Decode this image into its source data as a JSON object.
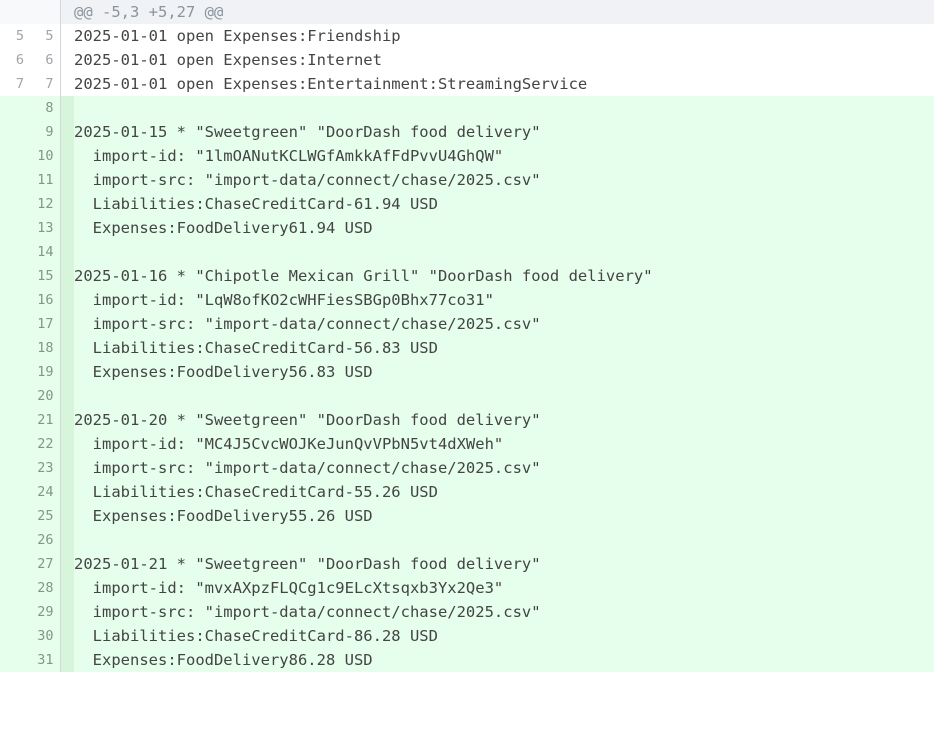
{
  "hunk_header": "@@ -5,3 +5,27 @@",
  "rows": [
    {
      "type": "hunk",
      "old": "",
      "new": "",
      "text_key": "hunk_header"
    },
    {
      "type": "context",
      "old": "5",
      "new": "5",
      "text": "2025-01-01 open Expenses:Friendship"
    },
    {
      "type": "context",
      "old": "6",
      "new": "6",
      "text": "2025-01-01 open Expenses:Internet"
    },
    {
      "type": "context",
      "old": "7",
      "new": "7",
      "text": "2025-01-01 open Expenses:Entertainment:StreamingService"
    },
    {
      "type": "added",
      "old": "",
      "new": "8",
      "text": ""
    },
    {
      "type": "added",
      "old": "",
      "new": "9",
      "text": "2025-01-15 * \"Sweetgreen\" \"DoorDash food delivery\""
    },
    {
      "type": "added",
      "old": "",
      "new": "10",
      "text": "  import-id: \"1lmOANutKCLWGfAmkkAfFdPvvU4GhQW\""
    },
    {
      "type": "added",
      "old": "",
      "new": "11",
      "text": "  import-src: \"import-data/connect/chase/2025.csv\""
    },
    {
      "type": "added",
      "old": "",
      "new": "12",
      "left": "  Liabilities:ChaseCreditCard",
      "right": "-61.94 USD"
    },
    {
      "type": "added",
      "old": "",
      "new": "13",
      "left": "  Expenses:FoodDelivery",
      "right": "61.94 USD"
    },
    {
      "type": "added",
      "old": "",
      "new": "14",
      "text": ""
    },
    {
      "type": "added",
      "old": "",
      "new": "15",
      "text": "2025-01-16 * \"Chipotle Mexican Grill\" \"DoorDash food delivery\""
    },
    {
      "type": "added",
      "old": "",
      "new": "16",
      "text": "  import-id: \"LqW8ofKO2cWHFiesSBGp0Bhx77co31\""
    },
    {
      "type": "added",
      "old": "",
      "new": "17",
      "text": "  import-src: \"import-data/connect/chase/2025.csv\""
    },
    {
      "type": "added",
      "old": "",
      "new": "18",
      "left": "  Liabilities:ChaseCreditCard",
      "right": "-56.83 USD"
    },
    {
      "type": "added",
      "old": "",
      "new": "19",
      "left": "  Expenses:FoodDelivery",
      "right": "56.83 USD"
    },
    {
      "type": "added",
      "old": "",
      "new": "20",
      "text": ""
    },
    {
      "type": "added",
      "old": "",
      "new": "21",
      "text": "2025-01-20 * \"Sweetgreen\" \"DoorDash food delivery\""
    },
    {
      "type": "added",
      "old": "",
      "new": "22",
      "text": "  import-id: \"MC4J5CvcWOJKeJunQvVPbN5vt4dXWeh\""
    },
    {
      "type": "added",
      "old": "",
      "new": "23",
      "text": "  import-src: \"import-data/connect/chase/2025.csv\""
    },
    {
      "type": "added",
      "old": "",
      "new": "24",
      "left": "  Liabilities:ChaseCreditCard",
      "right": "-55.26 USD"
    },
    {
      "type": "added",
      "old": "",
      "new": "25",
      "left": "  Expenses:FoodDelivery",
      "right": "55.26 USD"
    },
    {
      "type": "added",
      "old": "",
      "new": "26",
      "text": ""
    },
    {
      "type": "added",
      "old": "",
      "new": "27",
      "text": "2025-01-21 * \"Sweetgreen\" \"DoorDash food delivery\""
    },
    {
      "type": "added",
      "old": "",
      "new": "28",
      "text": "  import-id: \"mvxAXpzFLQCg1c9ELcXtsqxb3Yx2Qe3\""
    },
    {
      "type": "added",
      "old": "",
      "new": "29",
      "text": "  import-src: \"import-data/connect/chase/2025.csv\""
    },
    {
      "type": "added",
      "old": "",
      "new": "30",
      "left": "  Liabilities:ChaseCreditCard",
      "right": "-86.28 USD"
    },
    {
      "type": "added",
      "old": "",
      "new": "31",
      "left": "  Expenses:FoodDelivery",
      "right": "86.28 USD"
    }
  ]
}
